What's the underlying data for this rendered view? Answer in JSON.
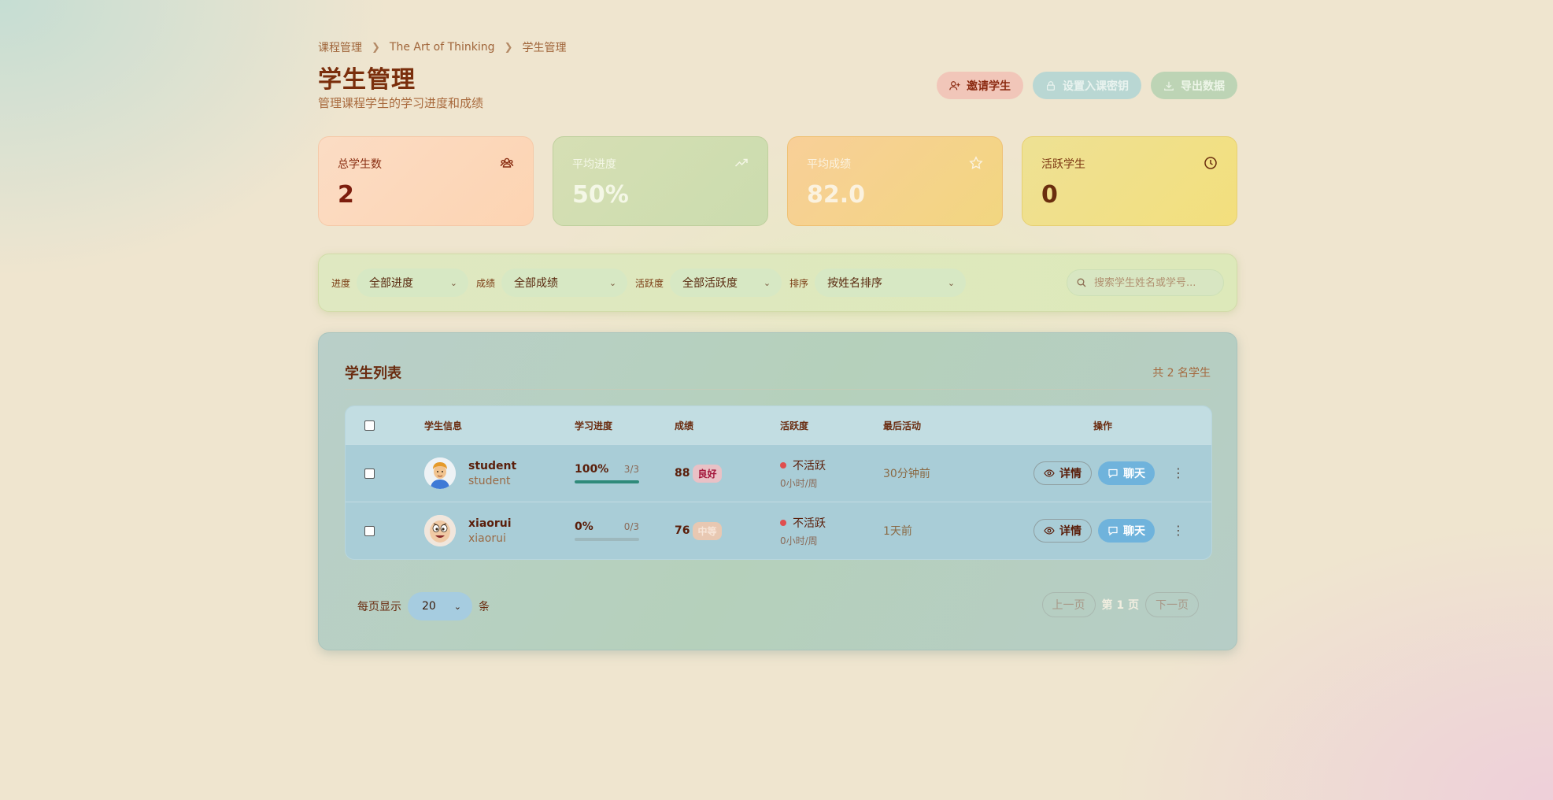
{
  "breadcrumb": [
    "课程管理",
    "The Art of Thinking",
    "学生管理"
  ],
  "page": {
    "title": "学生管理",
    "subtitle": "管理课程学生的学习进度和成绩"
  },
  "header_actions": {
    "invite": "邀请学生",
    "set_key": "设置入课密钥",
    "export": "导出数据"
  },
  "stats": [
    {
      "label": "总学生数",
      "value": "2",
      "icon": "users-icon"
    },
    {
      "label": "平均进度",
      "value": "50%",
      "icon": "trending-up-icon"
    },
    {
      "label": "平均成绩",
      "value": "82.0",
      "icon": "star-icon"
    },
    {
      "label": "活跃学生",
      "value": "0",
      "icon": "clock-icon"
    }
  ],
  "filters": {
    "progress_label": "进度",
    "progress_value": "全部进度",
    "score_label": "成绩",
    "score_value": "全部成绩",
    "activity_label": "活跃度",
    "activity_value": "全部活跃度",
    "sort_label": "排序",
    "sort_value": "按姓名排序",
    "search_placeholder": "搜索学生姓名或学号..."
  },
  "list": {
    "title": "学生列表",
    "count": "共 2 名学生",
    "columns": [
      "学生信息",
      "学习进度",
      "成绩",
      "活跃度",
      "最后活动",
      "操作"
    ],
    "rows": [
      {
        "name": "student",
        "username": "student",
        "progress_pct": "100%",
        "progress_frac": "3/3",
        "progress_value": 1.0,
        "score": "88",
        "grade": "良好",
        "status": "不活跃",
        "hours": "0小时/周",
        "last_activity": "30分钟前",
        "detail": "详情",
        "chat": "聊天"
      },
      {
        "name": "xiaorui",
        "username": "xiaorui",
        "progress_pct": "0%",
        "progress_frac": "0/3",
        "progress_value": 0.0,
        "score": "76",
        "grade": "中等",
        "status": "不活跃",
        "hours": "0小时/周",
        "last_activity": "1天前",
        "detail": "详情",
        "chat": "聊天"
      }
    ]
  },
  "pagination": {
    "per_page_label": "每页显示",
    "per_page_value": "20",
    "unit": "条",
    "prev": "上一页",
    "current": "第 1 页",
    "next": "下一页"
  }
}
